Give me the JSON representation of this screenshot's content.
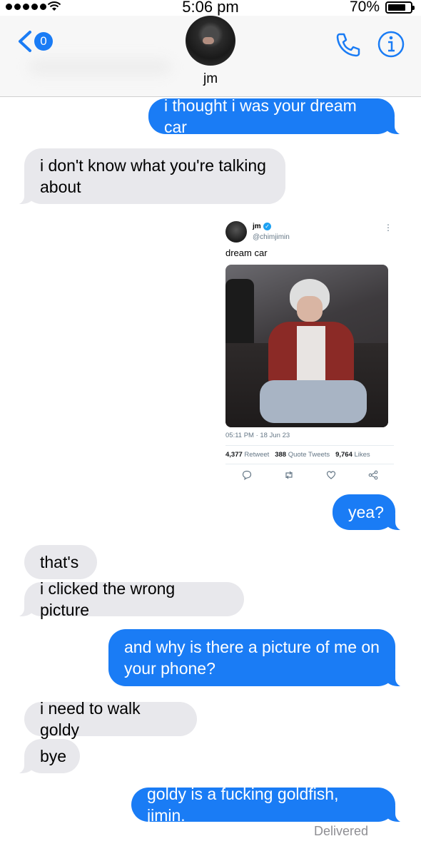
{
  "status_bar": {
    "time": "5:06 pm",
    "battery": "70%",
    "battery_level": 0.7
  },
  "header": {
    "back_badge": "0",
    "contact_name": "jm"
  },
  "messages": [
    {
      "side": "sent",
      "text": "i thought i was your dream car"
    },
    {
      "side": "received",
      "lines": [
        "i don't know what you're talking",
        "about"
      ]
    },
    {
      "side": "sent",
      "type": "tweet"
    },
    {
      "side": "sent",
      "text": "yea?"
    },
    {
      "side": "received",
      "text": "that's"
    },
    {
      "side": "received",
      "text": "i clicked the wrong picture"
    },
    {
      "side": "sent",
      "lines": [
        "and why is there a picture of me on",
        "your phone?"
      ]
    },
    {
      "side": "received",
      "text": "i need to walk goldy"
    },
    {
      "side": "received",
      "text": "bye"
    },
    {
      "side": "sent",
      "text": "goldy is a fucking goldfish, jimin."
    }
  ],
  "tweet": {
    "name": "jm",
    "handle": "@chimjimin",
    "text": "dream car",
    "timestamp": "05:11 PM · 18 Jun 23",
    "retweets": "4,377",
    "retweets_label": "Retweet",
    "quotes": "388",
    "quotes_label": "Quote Tweets",
    "likes": "9,764",
    "likes_label": "Likes",
    "icons": [
      "reply-icon",
      "retweet-icon",
      "like-icon",
      "share-icon"
    ]
  },
  "delivered_label": "Delivered",
  "colors": {
    "sent_bubble": "#1a7cf5",
    "received_bubble": "#e8e8ec",
    "accent": "#1a7cf5"
  }
}
